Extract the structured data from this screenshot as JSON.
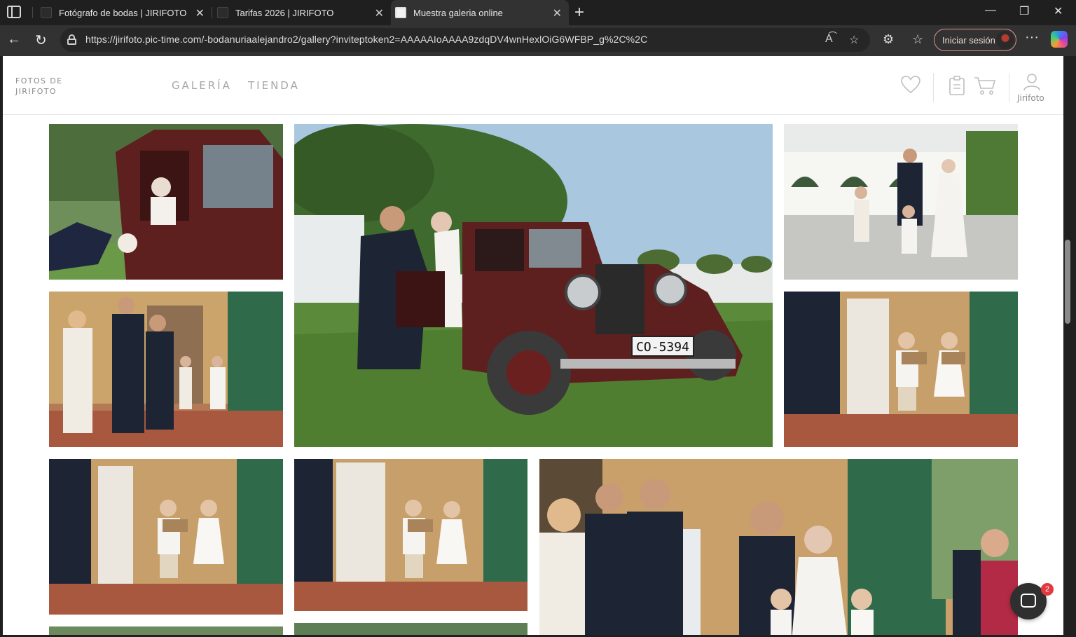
{
  "browser": {
    "tabs": [
      {
        "title": "Fotógrafo de bodas | JIRIFOTO",
        "active": false
      },
      {
        "title": "Tarifas 2026 | JIRIFOTO",
        "active": false
      },
      {
        "title": "Muestra galeria online",
        "active": true
      }
    ],
    "url": "https://jirifoto.pic-time.com/-bodanuriaalejandro2/gallery?inviteptoken2=AAAAAIoAAAA9zdqDV4wnHexlOiG6WFBP_g%2C%2C",
    "signin_label": "Iniciar sesión",
    "read_aloud_glyph": "A͡"
  },
  "site": {
    "logo_text": "FOTOS DE\nJIRIFOTO",
    "nav": [
      "GALERÍA",
      "TIENDA"
    ],
    "user_label": "Jirifoto"
  },
  "photos": [
    {
      "name": "photo-bride-in-vintage-car",
      "scene": "Bride seated in maroon vintage car, hand holding bouquet"
    },
    {
      "name": "photo-father-helps-bride-from-car",
      "scene": "Father helping bride out of maroon vintage car, plate CO-5394"
    },
    {
      "name": "photo-bride-walking-with-children",
      "scene": "Bride and father walking with two children by white tent"
    },
    {
      "name": "photo-guests-at-doorway",
      "scene": "Guests and children at green iron gate doorway"
    },
    {
      "name": "photo-children-with-signs",
      "scene": "Two children holding wooden signs at doorway"
    },
    {
      "name": "photo-children-with-signs-2",
      "scene": "Two children holding wooden signs at doorway"
    },
    {
      "name": "photo-children-with-signs-3",
      "scene": "Two children holding wooden signs at doorway"
    },
    {
      "name": "photo-bride-and-guests-entrance",
      "scene": "Bride arriving with father among guests at entrance"
    },
    {
      "name": "photo-partial-left",
      "scene": "partially visible photo"
    },
    {
      "name": "photo-partial-middle",
      "scene": "partially visible photo"
    }
  ],
  "license_plate": "CO-5394",
  "chat": {
    "badge_count": "2"
  },
  "colors": {
    "accent": "#e0393e",
    "car_maroon": "#5e1f1f",
    "grass": "#5b8a3a",
    "sky": "#a9c7df"
  }
}
